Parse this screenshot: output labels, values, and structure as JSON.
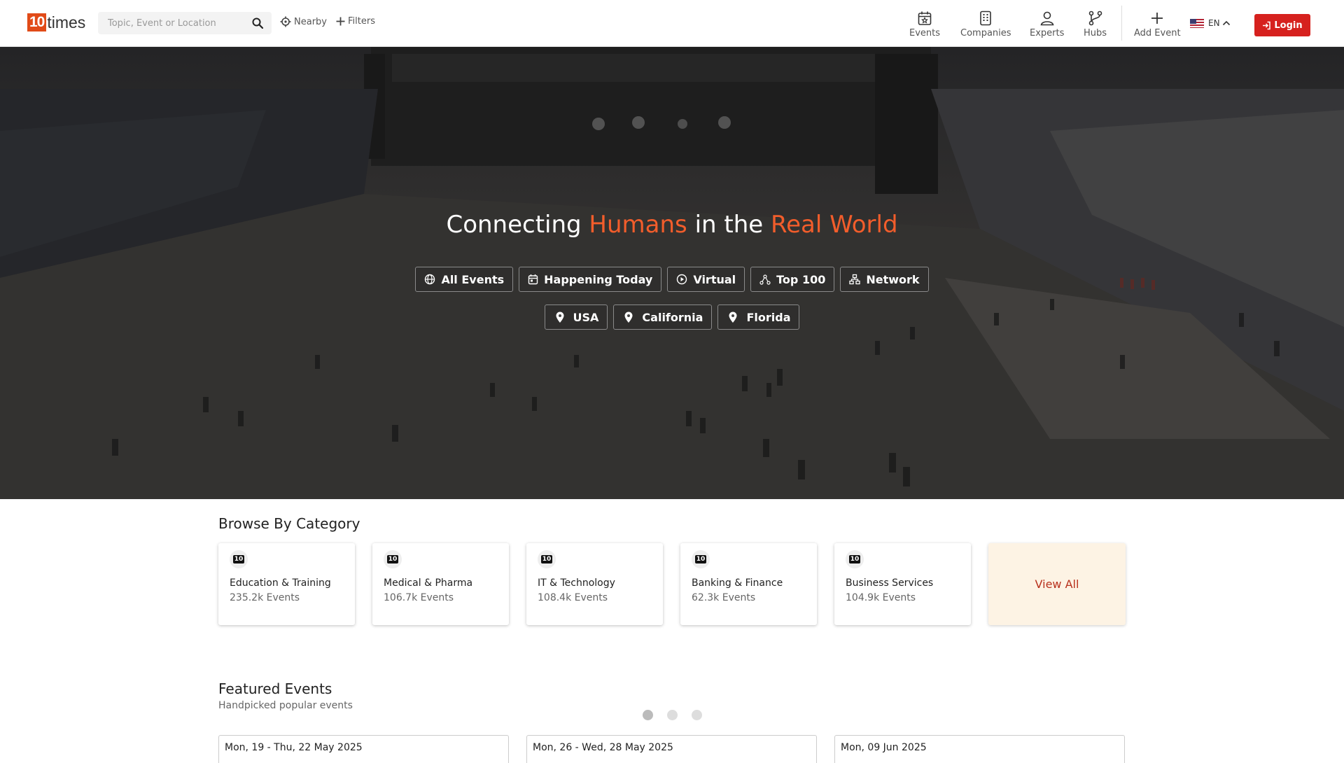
{
  "header": {
    "logo_number": "10",
    "logo_text": "times",
    "search_placeholder": "Topic, Event or Location",
    "nearby_label": "Nearby",
    "filters_label": "Filters",
    "menu": [
      {
        "label": "Events",
        "icon": "calendar-star-icon"
      },
      {
        "label": "Companies",
        "icon": "building-icon"
      },
      {
        "label": "Experts",
        "icon": "user-icon"
      },
      {
        "label": "Hubs",
        "icon": "branch-icon"
      },
      {
        "label": "Add Event",
        "icon": "plus-icon"
      }
    ],
    "language": "EN",
    "login_label": "Login"
  },
  "hero": {
    "title_part1": "Connecting ",
    "title_accent1": "Humans",
    "title_part2": " in the ",
    "title_accent2": "Real World",
    "chips_row1": [
      {
        "label": "All Events",
        "icon": "globe-icon"
      },
      {
        "label": "Happening Today",
        "icon": "calendar-icon"
      },
      {
        "label": "Virtual",
        "icon": "play-circle-icon"
      },
      {
        "label": "Top 100",
        "icon": "top-network-icon"
      },
      {
        "label": "Network",
        "icon": "network-icon"
      }
    ],
    "chips_row2": [
      {
        "label": "USA",
        "icon": "location-pin-icon"
      },
      {
        "label": "California",
        "icon": "location-pin-icon"
      },
      {
        "label": "Florida",
        "icon": "location-pin-icon"
      }
    ]
  },
  "categories": {
    "title": "Browse By Category",
    "items": [
      {
        "name": "Education & Training",
        "count": "235.2k Events",
        "badge": "10"
      },
      {
        "name": "Medical & Pharma",
        "count": "106.7k Events",
        "badge": "10"
      },
      {
        "name": "IT & Technology",
        "count": "108.4k Events",
        "badge": "10"
      },
      {
        "name": "Banking & Finance",
        "count": "62.3k Events",
        "badge": "10"
      },
      {
        "name": "Business Services",
        "count": "104.9k Events",
        "badge": "10"
      }
    ],
    "view_all_label": "View All"
  },
  "featured": {
    "title": "Featured Events",
    "subtitle": "Handpicked popular events",
    "carousel_active_index": 0,
    "carousel_pages": 3,
    "events": [
      {
        "date": "Mon, 19 - Thu, 22 May 2025"
      },
      {
        "date": "Mon, 26 - Wed, 28 May 2025"
      },
      {
        "date": "Mon, 09 Jun 2025"
      }
    ]
  },
  "colors": {
    "brand_orange": "#e14b18",
    "accent_text": "#f25d2b",
    "login_red": "#d6211e",
    "view_all_bg": "#fdf3e4"
  }
}
